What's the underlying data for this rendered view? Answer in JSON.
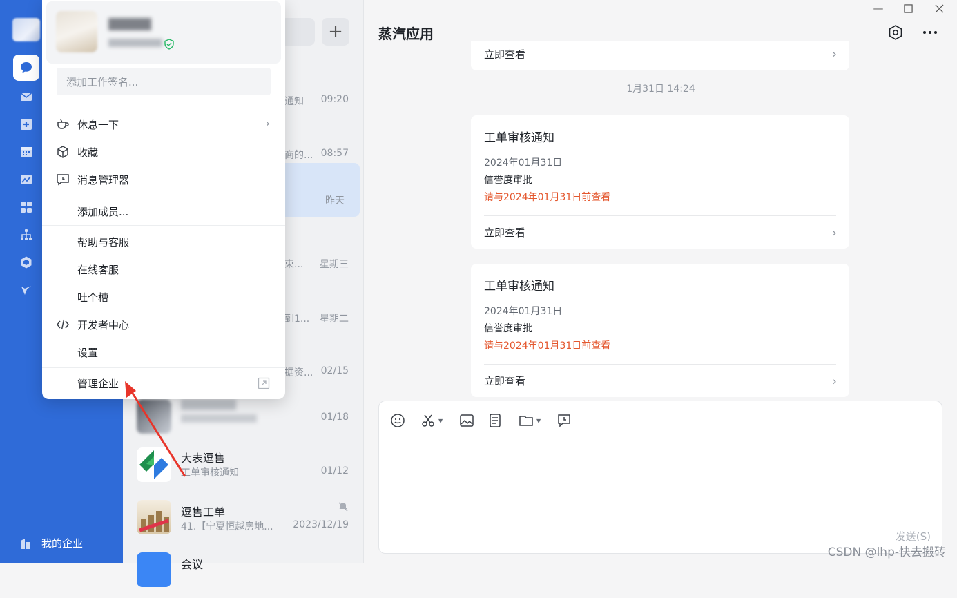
{
  "rail": {
    "items": [
      {
        "icon": "chat-bubble-icon",
        "active": true
      },
      {
        "icon": "mail-icon"
      },
      {
        "icon": "workbench-icon"
      },
      {
        "icon": "calendar-icon"
      },
      {
        "icon": "report-icon"
      },
      {
        "icon": "apps-grid-icon"
      },
      {
        "icon": "org-chart-icon"
      },
      {
        "icon": "hexagon-app-icon"
      },
      {
        "icon": "spark-icon"
      }
    ],
    "my_org_label": "我的企业"
  },
  "conversations": [
    {
      "snippet": "通知",
      "time": "09:20"
    },
    {
      "snippet": "商的...",
      "time": "08:57"
    },
    {
      "snippet": "",
      "time": "昨天",
      "selected": true
    },
    {
      "snippet": "束...",
      "time": "星期三"
    },
    {
      "snippet": "到1...",
      "time": "星期二"
    },
    {
      "snippet": "据资...",
      "time": "02/15"
    },
    {
      "snippet": "",
      "time": "01/18"
    },
    {
      "name": "大表逗售",
      "snippet": "工单审核通知",
      "time": "01/12"
    },
    {
      "name": "逗售工单",
      "snippet": "41.【宁夏恒越房地...",
      "time": "2023/12/19",
      "muted": true
    },
    {
      "name": "会议",
      "snippet": "",
      "time": ""
    }
  ],
  "chat": {
    "title": "蒸汽应用",
    "top_link": "立即查看",
    "timestamp": "1月31日 14:24",
    "cards": [
      {
        "title": "工单审核通知",
        "date": "2024年01月31日",
        "subtitle": "信誉度审批",
        "warning": "请与2024年01月31日前查看",
        "link": "立即查看"
      },
      {
        "title": "工单审核通知",
        "date": "2024年01月31日",
        "subtitle": "信誉度审批",
        "warning": "请与2024年01月31日前查看",
        "link": "立即查看"
      }
    ],
    "composer": {
      "tools": [
        "emoji-icon",
        "scissors-icon",
        "image-icon",
        "document-icon",
        "folder-icon",
        "reminder-icon"
      ],
      "send_label": "发送(S)"
    },
    "watermark": "CSDN @lhp-快去搬砖"
  },
  "menu": {
    "signature_placeholder": "添加工作签名...",
    "items": [
      {
        "label": "休息一下",
        "icon": "coffee-cup-icon",
        "has_submenu": true
      },
      {
        "label": "收藏",
        "icon": "box-icon"
      },
      {
        "label": "消息管理器",
        "icon": "message-manager-icon"
      },
      {
        "label": "添加成员..."
      },
      {
        "label": "帮助与客服"
      },
      {
        "label": "在线客服"
      },
      {
        "label": "吐个槽"
      },
      {
        "label": "开发者中心",
        "icon": "code-icon"
      },
      {
        "label": "设置"
      },
      {
        "label": "管理企业",
        "external": true
      }
    ]
  },
  "colors": {
    "rail": "#2f6bd8",
    "warning": "#e4572e",
    "selected_row": "#d8e5f8",
    "annotation_arrow": "#e8352a"
  }
}
